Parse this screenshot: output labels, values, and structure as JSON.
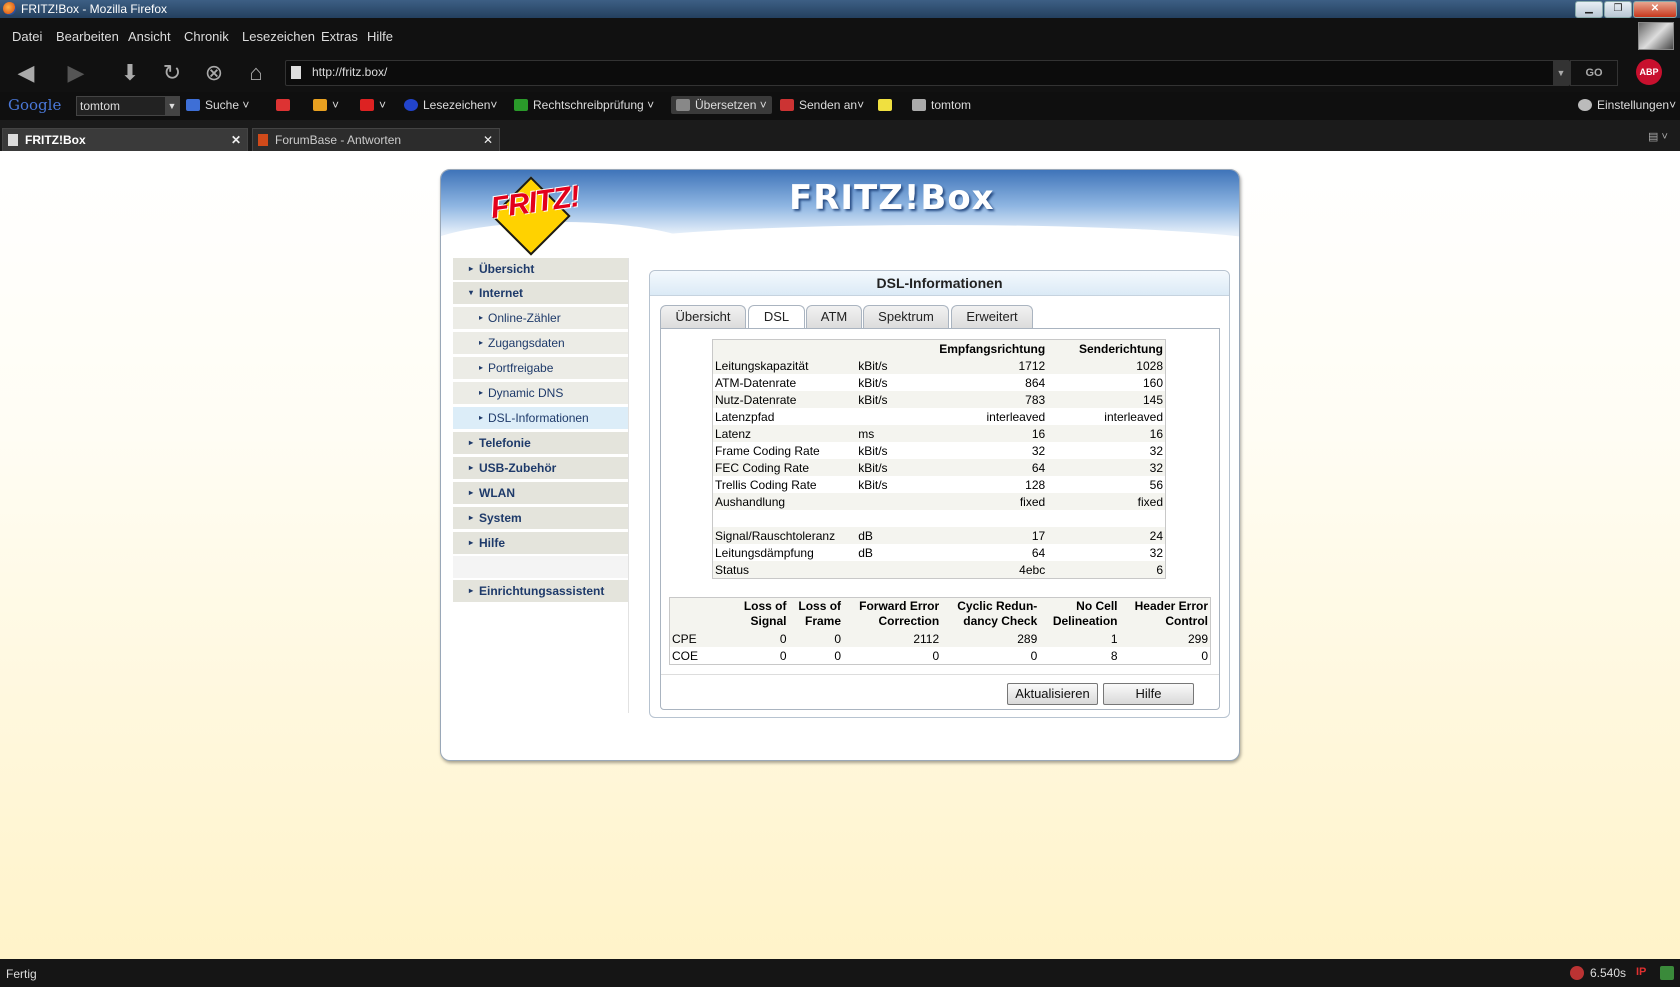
{
  "window": {
    "title": "FRITZ!Box - Mozilla Firefox"
  },
  "menu": [
    "Datei",
    "Bearbeiten",
    "Ansicht",
    "Chronik",
    "Lesezeichen",
    "Extras",
    "Hilfe"
  ],
  "navigation": {
    "url": "http://fritz.box/",
    "go_label": "GO",
    "abp_label": "ABP"
  },
  "google_toolbar": {
    "logo": "Google",
    "search_value": "tomtom",
    "search_label": "Suche",
    "bookmarks_label": "Lesezeichen",
    "spellcheck_label": "Rechtschreibprüfung",
    "translate_label": "Übersetzen",
    "send_label": "Senden an",
    "tomtom_label": "tomtom",
    "settings_label": "Einstellungen"
  },
  "tabs": [
    {
      "label": "FRITZ!Box",
      "active": true
    },
    {
      "label": "ForumBase - Antworten",
      "active": false
    }
  ],
  "fritz": {
    "logo_text": "FRITZ!",
    "brand": "FRITZ!Box",
    "nav": {
      "uebersicht": "Übersicht",
      "internet": "Internet",
      "online_zaehler": "Online-Zähler",
      "zugangsdaten": "Zugangsdaten",
      "portfreigabe": "Portfreigabe",
      "dynamic_dns": "Dynamic DNS",
      "dsl_informationen": "DSL-Informationen",
      "telefonie": "Telefonie",
      "usb_zubehoer": "USB-Zubehör",
      "wlan": "WLAN",
      "system": "System",
      "hilfe": "Hilfe",
      "einrichtungsassistent": "Einrichtungsassistent"
    },
    "panel_title": "DSL-Informationen",
    "panel_tabs": [
      "Übersicht",
      "DSL",
      "ATM",
      "Spektrum",
      "Erweitert"
    ],
    "dsl_table": {
      "headers": [
        "Empfangsrichtung",
        "Senderichtung"
      ],
      "rows": [
        [
          "Leitungskapazität",
          "kBit/s",
          "1712",
          "1028"
        ],
        [
          "ATM-Datenrate",
          "kBit/s",
          "864",
          "160"
        ],
        [
          "Nutz-Datenrate",
          "kBit/s",
          "783",
          "145"
        ],
        [
          "Latenzpfad",
          "",
          "interleaved",
          "interleaved"
        ],
        [
          "Latenz",
          "ms",
          "16",
          "16"
        ],
        [
          "Frame Coding Rate",
          "kBit/s",
          "32",
          "32"
        ],
        [
          "FEC Coding Rate",
          "kBit/s",
          "64",
          "32"
        ],
        [
          "Trellis Coding Rate",
          "kBit/s",
          "128",
          "56"
        ],
        [
          "Aushandlung",
          "",
          "fixed",
          "fixed"
        ],
        [
          "",
          "",
          "",
          ""
        ],
        [
          "Signal/Rauschtoleranz",
          "dB",
          "17",
          "24"
        ],
        [
          "Leitungsdämpfung",
          "dB",
          "64",
          "32"
        ],
        [
          "Status",
          "",
          "4ebc",
          "6"
        ]
      ]
    },
    "error_table": {
      "headers": [
        [
          "Loss of",
          "Signal"
        ],
        [
          "Loss of",
          "Frame"
        ],
        [
          "Forward Error",
          "Correction"
        ],
        [
          "Cyclic Redun-",
          "dancy Check"
        ],
        [
          "No Cell",
          "Delineation"
        ],
        [
          "Header Error",
          "Control"
        ]
      ],
      "rows": [
        [
          "CPE",
          "0",
          "0",
          "2112",
          "289",
          "1",
          "299"
        ],
        [
          "COE",
          "0",
          "0",
          "0",
          "0",
          "8",
          "0"
        ]
      ]
    },
    "buttons": {
      "refresh": "Aktualisieren",
      "help": "Hilfe"
    }
  },
  "statusbar": {
    "text": "Fertig",
    "timing": "6.540s",
    "ip": "IP"
  }
}
